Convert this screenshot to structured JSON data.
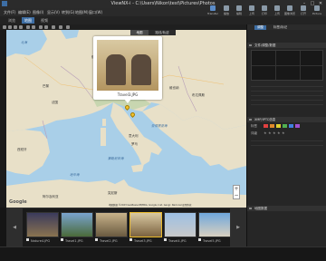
{
  "app": {
    "title": "ViewNX-i - C:\\Users\\Nikon\\test\\Pictures\\Photos",
    "window_controls": [
      "–",
      "□",
      "✕"
    ]
  },
  "menubar": {
    "items": [
      "文件(F)",
      "编辑(E)",
      "图像(I)",
      "显示(V)",
      "转到(G)",
      "地图(M)",
      "窗口(W)",
      "帮助(H)"
    ]
  },
  "modes": {
    "tabs": [
      "浏览",
      "地图",
      "视频"
    ]
  },
  "toolbar_right": {
    "buttons": [
      "Transfer",
      "播放",
      "编辑",
      "上传",
      "打印",
      "上传",
      "图像浏览",
      "打开",
      "Picture"
    ]
  },
  "map": {
    "tabs": [
      "地图",
      "路线/轨迹"
    ],
    "labels": {
      "sea_north": "北海",
      "sea_adriatic": "亚得里亚海",
      "sea_tyrrhenian": "第勒尼安海",
      "sea_med": "地中海",
      "germany": "德国",
      "france": "法国",
      "italy": "意大利",
      "spain": "西班牙",
      "rome": "罗马",
      "paris": "巴黎",
      "vienna": "维也纳",
      "budapest": "布达佩斯",
      "tunisia": "突尼斯",
      "algeria": "阿尔及利亚"
    },
    "popup_caption": "Travel3.JPG",
    "zoom_in": "+",
    "zoom_out": "−",
    "google": "Google",
    "footer": "地图数据 ©2023 GeoBasis-DE/BKG, Google, Inst. Geogr. Nacional  使用条款"
  },
  "right_panel": {
    "tabs": [
      "调整",
      "标签/标记"
    ],
    "section1_title": "文件/调整/数据",
    "section2_title": "XMP/IPTC信息",
    "section3_title": "地图数据",
    "rating_label": "评级",
    "tag_label": "标签",
    "colors": {
      "label_colors": [
        "#e04040",
        "#e08a2a",
        "#e0d030",
        "#50b050",
        "#4080e0",
        "#a050d0",
        "#888888",
        "#cccccc"
      ]
    }
  },
  "filmstrip": {
    "prev": "◀",
    "next": "▶",
    "thumbnails": [
      {
        "caption": "Nature4.JPG",
        "selected": false,
        "c1": "#3b3b5c",
        "c2": "#8a7350"
      },
      {
        "caption": "Travel1.JPG",
        "selected": false,
        "c1": "#7aa4cf",
        "c2": "#4a6a3a"
      },
      {
        "caption": "Travel2.JPG",
        "selected": false,
        "c1": "#c8b28a",
        "c2": "#6a5a40"
      },
      {
        "caption": "Travel3.JPG",
        "selected": true,
        "c1": "#d9c9a2",
        "c2": "#7b6240"
      },
      {
        "caption": "Travel4.JPG",
        "selected": false,
        "c1": "#9dc0e4",
        "c2": "#c9c9c9"
      },
      {
        "caption": "Travel5.JPG",
        "selected": false,
        "c1": "#6fa7dc",
        "c2": "#d8d0c0"
      }
    ]
  }
}
